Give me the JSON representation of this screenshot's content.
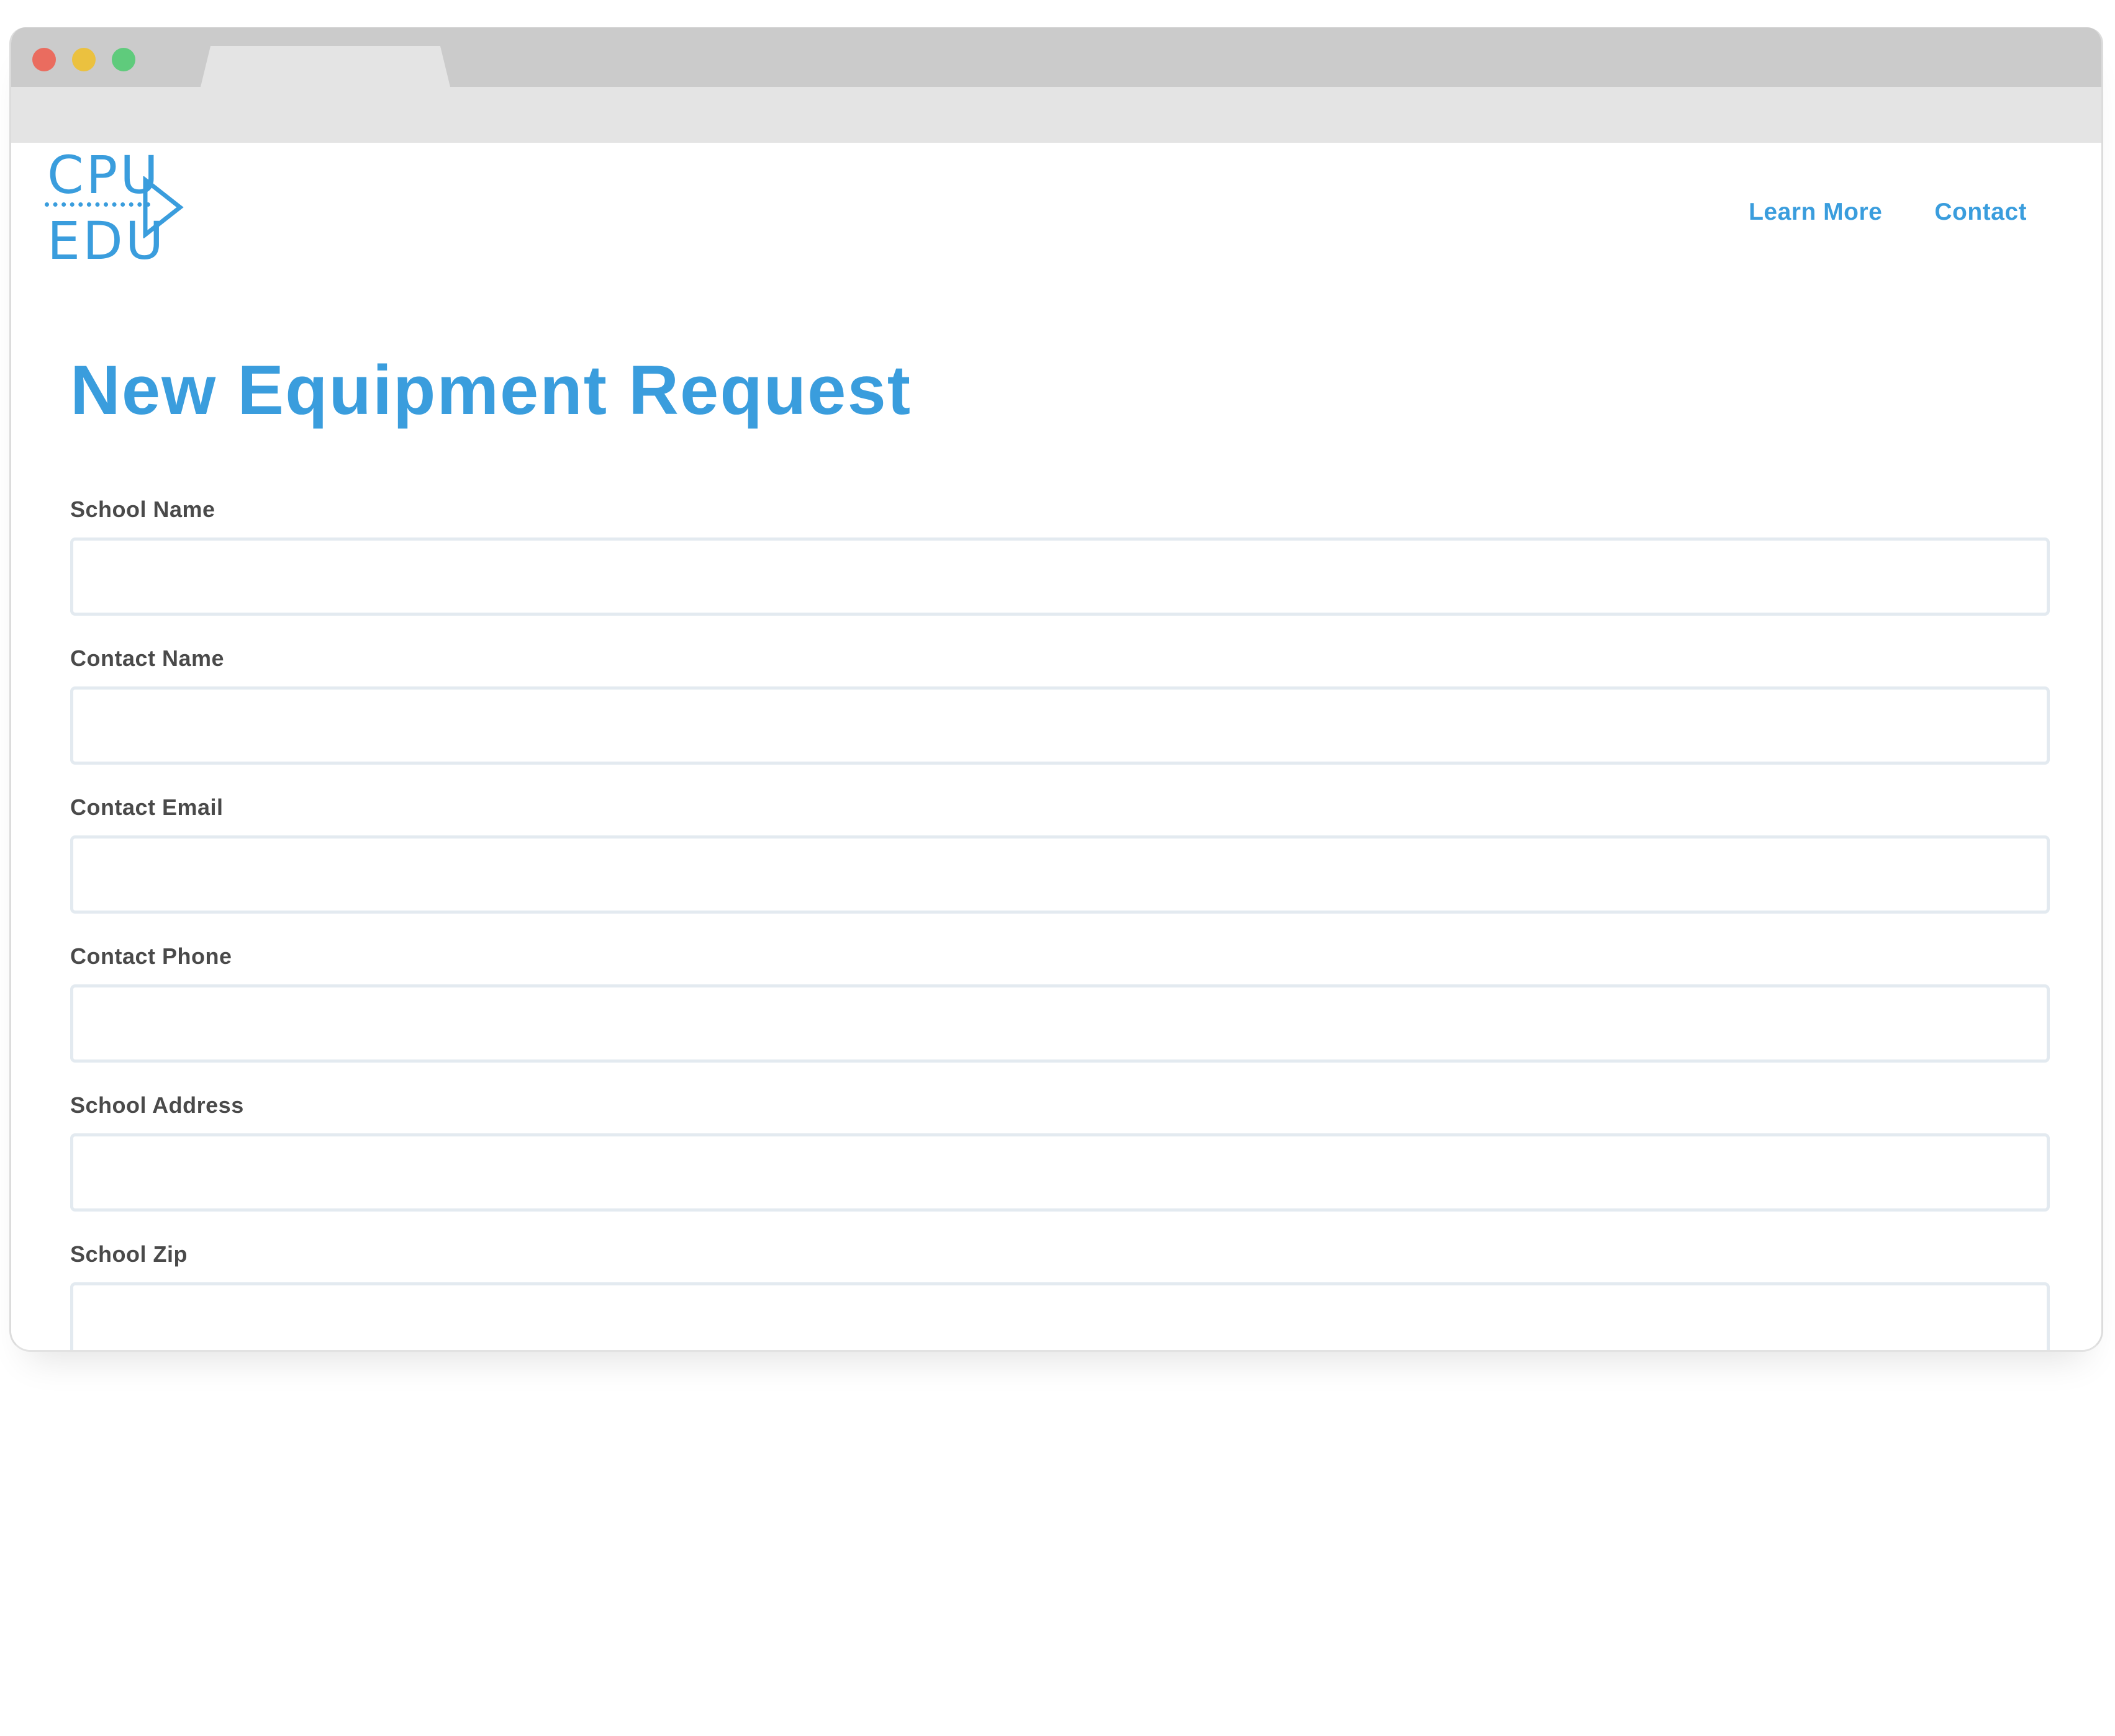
{
  "logo": {
    "line1": "CPU",
    "line2": "EDU"
  },
  "nav": {
    "learn_more": "Learn More",
    "contact": "Contact"
  },
  "form": {
    "title": "New Equipment Request",
    "fields": [
      {
        "label": "School Name",
        "value": "",
        "placeholder": ""
      },
      {
        "label": "Contact Name",
        "value": "",
        "placeholder": ""
      },
      {
        "label": "Contact Email",
        "value": "",
        "placeholder": ""
      },
      {
        "label": "Contact Phone",
        "value": "",
        "placeholder": ""
      },
      {
        "label": "School Address",
        "value": "",
        "placeholder": ""
      },
      {
        "label": "School Zip",
        "value": "",
        "placeholder": ""
      }
    ]
  },
  "colors": {
    "accent": "#3a9ddd",
    "label": "#4a4a4a",
    "input_border": "#e3eaf0"
  }
}
